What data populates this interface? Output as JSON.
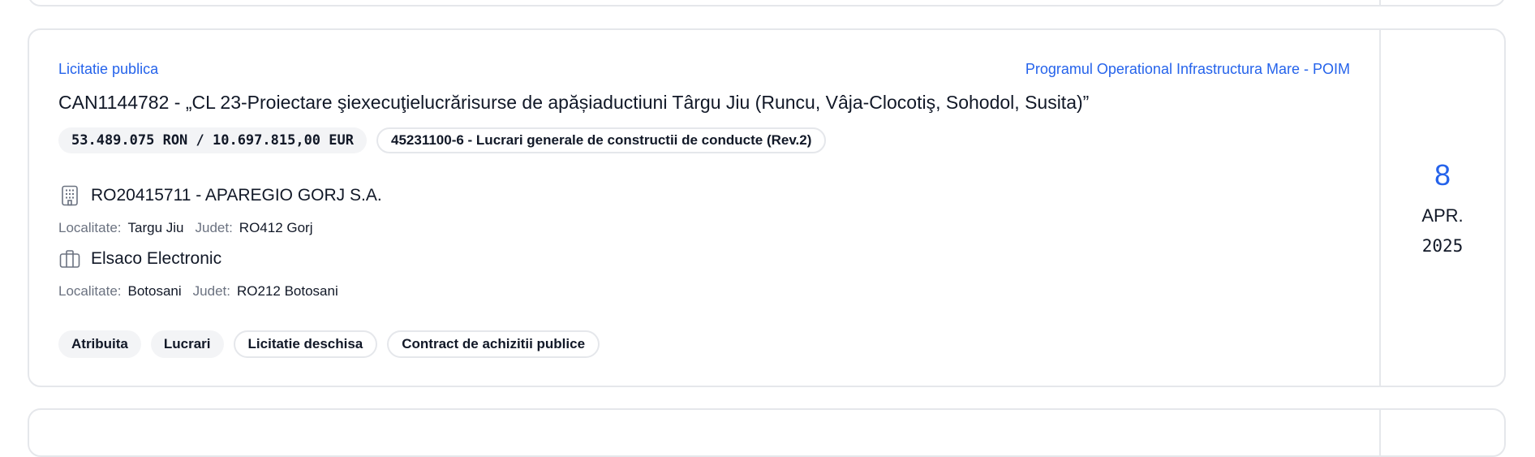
{
  "tender": {
    "procedure_type": "Licitatie publica",
    "program": "Programul Operational Infrastructura Mare - POIM",
    "title": "CAN1144782 - „CL 23-Proiectare şiexecuţielucrărisurse de apășiaductiuni Târgu Jiu (Runcu, Vâja-Clocotiş, Sohodol, Susita)”",
    "value": "53.489.075 RON / 10.697.815,00 EUR",
    "cpv": "45231100-6 - Lucrari generale de constructii de conducte (Rev.2)",
    "authority": {
      "icon": "building-icon",
      "name": "RO20415711 - APAREGIO GORJ S.A.",
      "locality_label": "Localitate:",
      "locality": "Targu Jiu",
      "county_label": "Judet:",
      "county": "RO412 Gorj"
    },
    "supplier": {
      "icon": "briefcase-icon",
      "name": "Elsaco Electronic",
      "locality_label": "Localitate:",
      "locality": "Botosani",
      "county_label": "Judet:",
      "county": "RO212 Botosani"
    },
    "tags": [
      {
        "label": "Atribuita",
        "style": "filled"
      },
      {
        "label": "Lucrari",
        "style": "filled"
      },
      {
        "label": "Licitatie deschisa",
        "style": "outline"
      },
      {
        "label": "Contract de achizitii publice",
        "style": "outline"
      }
    ],
    "date": {
      "day": "8",
      "month": "APR.",
      "year": "2025"
    }
  },
  "colors": {
    "accent": "#2563eb",
    "border": "#e5e7eb",
    "pill_bg": "#f3f4f6"
  }
}
